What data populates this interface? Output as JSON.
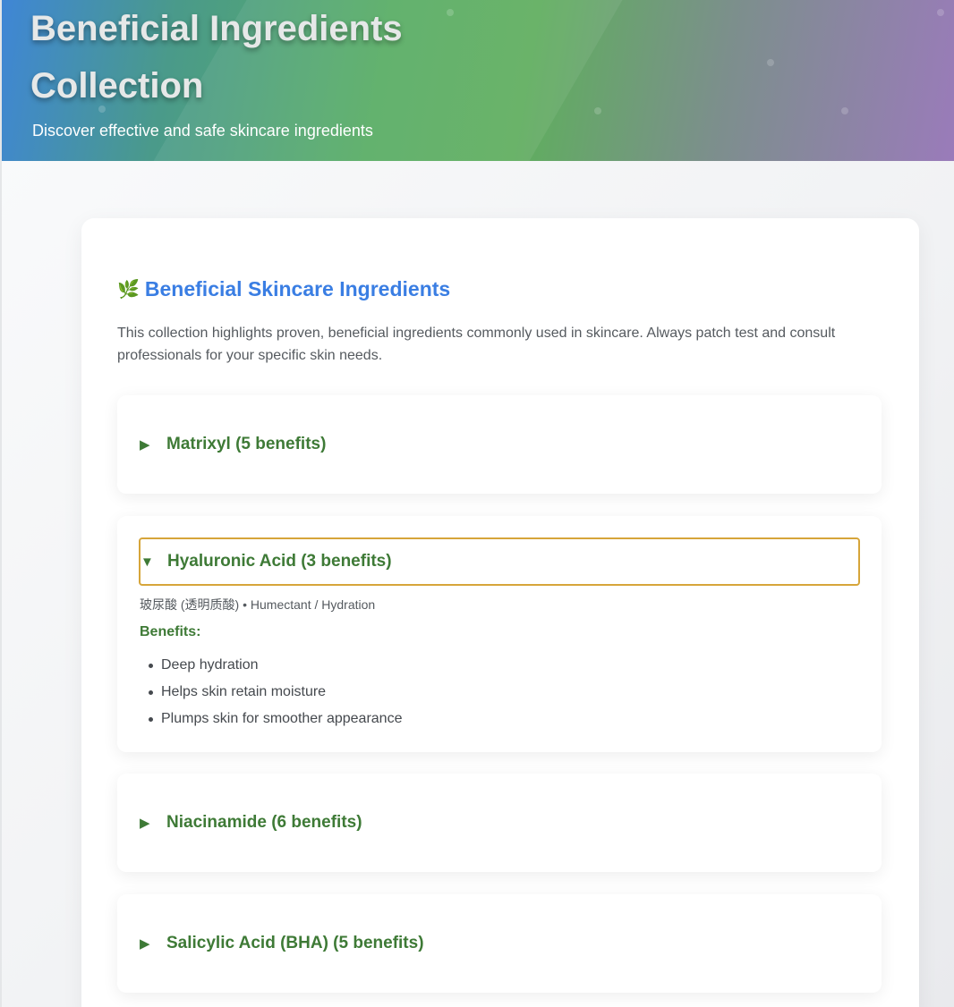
{
  "hero": {
    "title_line1": "Beneficial Ingredients",
    "title_line2": "Collection",
    "subtitle": "Discover effective and safe skincare ingredients"
  },
  "section": {
    "icon": "leaf-icon",
    "title": "Beneficial Skincare Ingredients",
    "description": "This collection highlights proven, beneficial ingredients commonly used in skincare. Always patch test and consult professionals for your specific skin needs."
  },
  "ingredients": [
    {
      "title": "Matrixyl (5 benefits)",
      "expanded": false
    },
    {
      "title": "Hyaluronic Acid (3 benefits)",
      "expanded": true,
      "meta": "玻尿酸 (透明质酸) • Humectant / Hydration",
      "benefits_label": "Benefits:",
      "benefits": [
        "Deep hydration",
        "Helps skin retain moisture",
        "Plumps skin for smoother appearance"
      ]
    },
    {
      "title": "Niacinamide (6 benefits)",
      "expanded": false
    },
    {
      "title": "Salicylic Acid (BHA) (5 benefits)",
      "expanded": false
    }
  ],
  "colors": {
    "accent_blue": "#3a7ee3",
    "accent_green": "#3e7a36",
    "focus_outline": "#d6a53a"
  }
}
